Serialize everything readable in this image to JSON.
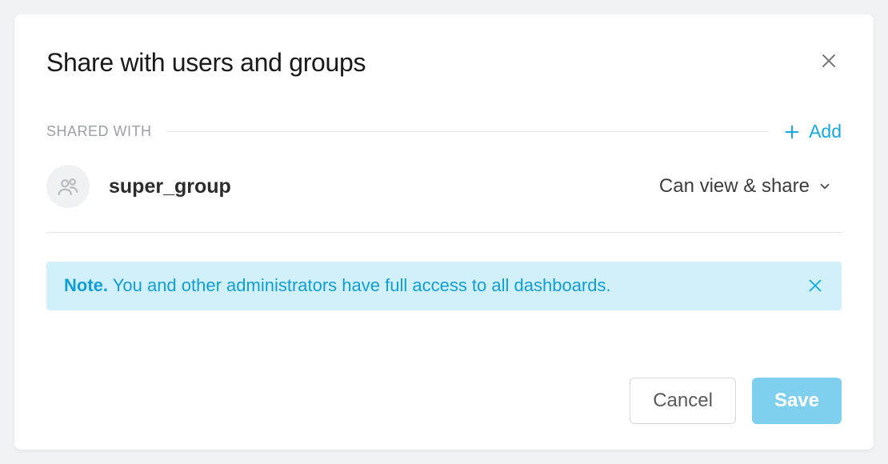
{
  "modal": {
    "title": "Share with users and groups"
  },
  "section": {
    "label": "SHARED WITH",
    "add_label": "Add"
  },
  "shared_with": [
    {
      "name": "super_group",
      "permission": "Can view & share"
    }
  ],
  "note": {
    "prefix": "Note.",
    "text": " You and other administrators have full access to all dashboards."
  },
  "footer": {
    "cancel": "Cancel",
    "save": "Save"
  }
}
